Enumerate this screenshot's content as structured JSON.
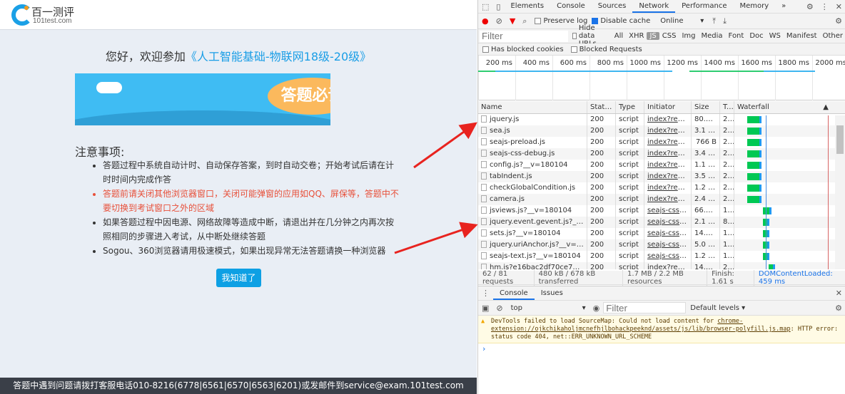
{
  "page": {
    "logo_cn": "百一测评",
    "logo_en": "101test.com",
    "welcome_prefix": "您好，欢迎参加",
    "course": "《人工智能基础-物联网18级-20级》",
    "banner_text": "答题必读",
    "notes_title": "注意事项:",
    "notes": [
      "答题过程中系统自动计时、自动保存答案，到时自动交卷；开始考试后请在计时时间内完成作答",
      "答题前请关闭其他浏览器窗口，关闭可能弹窗的应用如QQ、屏保等，答题中不要切换到考试窗口之外的区域",
      "如果答题过程中因电源、网络故障等造成中断，请退出并在几分钟之内再次按照相同的步骤进入考试，从中断处继续答题",
      "Sogou、360浏览器请用极速模式，如果出现异常无法答题请换一种浏览器"
    ],
    "ok_button": "我知道了",
    "footer": "答题中遇到问题请拨打客服电话010-8216(6778|6561|6570|6563|6201)或发邮件到service@exam.101test.com"
  },
  "devtools": {
    "tabs": [
      "Elements",
      "Console",
      "Sources",
      "Network",
      "Performance",
      "Memory"
    ],
    "active_tab": "Network",
    "more": "»",
    "toolbar": {
      "preserve_log": "Preserve log",
      "disable_cache": "Disable cache",
      "throttle": "Online"
    },
    "filter": {
      "placeholder": "Filter",
      "hide_data_urls": "Hide data URLs",
      "types": [
        "All",
        "XHR",
        "JS",
        "CSS",
        "Img",
        "Media",
        "Font",
        "Doc",
        "WS",
        "Manifest",
        "Other"
      ],
      "active_type": "JS",
      "has_blocked_cookies": "Has blocked cookies",
      "blocked_requests": "Blocked Requests"
    },
    "timeline_ticks": [
      "200 ms",
      "400 ms",
      "600 ms",
      "800 ms",
      "1000 ms",
      "1200 ms",
      "1400 ms",
      "1600 ms",
      "1800 ms",
      "2000 ms"
    ],
    "columns": [
      "Name",
      "Status",
      "Type",
      "Initiator",
      "Size",
      "T...",
      "Waterfall"
    ],
    "rows": [
      [
        "jquery.js",
        "200",
        "script",
        "index?redire...",
        "80.9 kB",
        "2..."
      ],
      [
        "sea.js",
        "200",
        "script",
        "index?redire...",
        "3.1 kB",
        "2..."
      ],
      [
        "seajs-preload.js",
        "200",
        "script",
        "index?redire...",
        "766 B",
        "2..."
      ],
      [
        "seajs-css-debug.js",
        "200",
        "script",
        "index?redire...",
        "3.4 kB",
        "2..."
      ],
      [
        "config.js?__v=180104",
        "200",
        "script",
        "index?redire...",
        "1.1 kB",
        "2..."
      ],
      [
        "tabIndent.js",
        "200",
        "script",
        "index?redire...",
        "3.5 kB",
        "2..."
      ],
      [
        "checkGlobalCondition.js",
        "200",
        "script",
        "index?redire...",
        "1.2 kB",
        "2..."
      ],
      [
        "camera.js",
        "200",
        "script",
        "index?redire...",
        "2.4 kB",
        "2..."
      ],
      [
        "jsviews.js?__v=180104",
        "200",
        "script",
        "seajs-css-de...",
        "66.2 kB",
        "1..."
      ],
      [
        "jquery.event.gevent.js?__v=180...",
        "200",
        "script",
        "seajs-css-de...",
        "2.1 kB",
        "8..."
      ],
      [
        "sets.js?__v=180104",
        "200",
        "script",
        "seajs-css-de...",
        "14.6 kB",
        "1..."
      ],
      [
        "jquery.uriAnchor.js?__v=180104",
        "200",
        "script",
        "seajs-css-de...",
        "5.0 kB",
        "1..."
      ],
      [
        "seajs-text.js?__v=180104",
        "200",
        "script",
        "seajs-css-de...",
        "1.2 kB",
        "1..."
      ],
      [
        "hm.js?e16bac2df70ce77e2022",
        "200",
        "script",
        "index?redire...",
        "14.2 kB",
        "2..."
      ]
    ],
    "status": {
      "requests": "62 / 81 requests",
      "transferred": "480 kB / 678 kB transferred",
      "resources": "1.7 MB / 2.2 MB resources",
      "finish": "Finish: 1.61 s",
      "dcl": "DOMContentLoaded: 459 ms"
    },
    "drawer": {
      "tabs": [
        "Console",
        "Issues"
      ],
      "context": "top",
      "filter_placeholder": "Filter",
      "levels": "Default levels ▾",
      "warning": {
        "text1": "DevTools failed to load SourceMap: Could not load content for ",
        "link": "chrome-extension://ojkchikaholjmcnefhjlbohackpeeknd/assets/js/lib/browser-polyfill.js.map",
        "text2": ": HTTP error: status code 404, net::ERR_UNKNOWN_URL_SCHEME"
      },
      "prompt": "›"
    }
  },
  "colors": {
    "accent": "#1a9ee6",
    "warning_text": "#e8503a",
    "button": "#0ea0e4",
    "annotation_arrow": "#e8231f"
  }
}
